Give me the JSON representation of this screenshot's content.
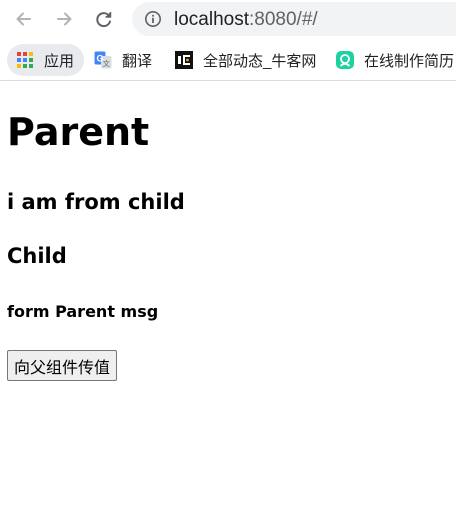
{
  "browser": {
    "url_host": "localhost",
    "url_rest": ":8080/#/",
    "bookmarks": [
      {
        "label": "应用",
        "icon": "apps-grid-icon"
      },
      {
        "label": "翻译",
        "icon": "google-translate-icon"
      },
      {
        "label": "全部动态_牛客网",
        "icon": "nowcoder-icon"
      },
      {
        "label": "在线制作简历",
        "icon": "resume-icon"
      }
    ],
    "colors": {
      "omnibox_bg": "#f1f3f4",
      "apps_chip_bg": "#e8eaed",
      "translate_blue": "#4285f4",
      "resume_green": "#1ed1a0"
    }
  },
  "page": {
    "title": "Parent",
    "child_message": "i am from child",
    "child_title": "Child",
    "parent_message": "form Parent msg",
    "send_button_label": "向父组件传值"
  }
}
